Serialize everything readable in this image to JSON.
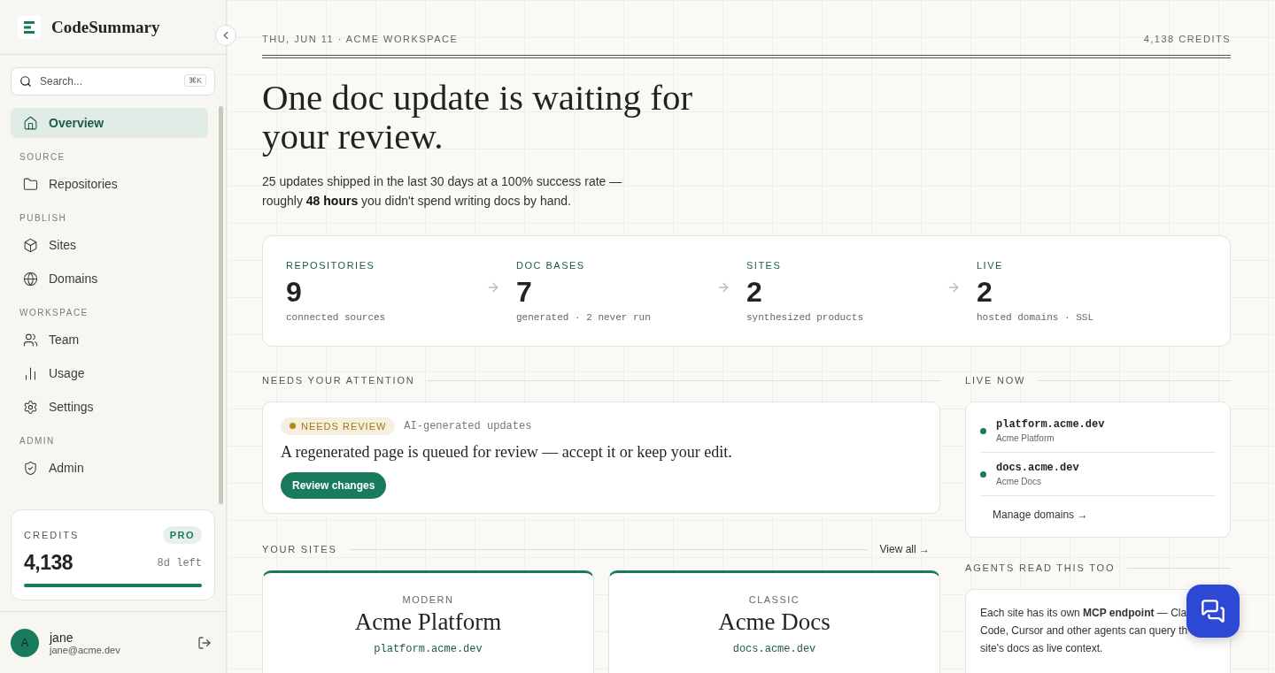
{
  "brand": {
    "name": "CodeSummary"
  },
  "search": {
    "placeholder": "Search...",
    "shortcut": "⌘K"
  },
  "nav": [
    {
      "kind": "item",
      "label": "Overview",
      "selected": true
    },
    {
      "kind": "section",
      "label": "SOURCE"
    },
    {
      "kind": "item",
      "label": "Repositories",
      "selected": false
    },
    {
      "kind": "section",
      "label": "PUBLISH"
    },
    {
      "kind": "item",
      "label": "Sites",
      "selected": false
    },
    {
      "kind": "item",
      "label": "Domains",
      "selected": false
    },
    {
      "kind": "section",
      "label": "WORKSPACE"
    },
    {
      "kind": "item",
      "label": "Team",
      "selected": false
    },
    {
      "kind": "item",
      "label": "Usage",
      "selected": false
    },
    {
      "kind": "item",
      "label": "Settings",
      "selected": false
    },
    {
      "kind": "section",
      "label": "ADMIN"
    },
    {
      "kind": "item",
      "label": "Admin",
      "selected": false
    }
  ],
  "credits": {
    "label": "CREDITS",
    "plan": "PRO",
    "amount": "4,138",
    "remaining": "8d left",
    "level": 1
  },
  "user": {
    "initial": "A",
    "name": "jane",
    "email": "jane@acme.dev"
  },
  "header": {
    "context": "THU, JUN 11 · ACME WORKSPACE",
    "credits": "4,138 CREDITS"
  },
  "headline": "One doc update is waiting for your review.",
  "summary": "25 updates shipped in the last 30 days at a 100% success rate — roughly **48 hours** you didn't spend writing docs by hand.",
  "stats": [
    {
      "label": "REPOSITORIES",
      "value": "9",
      "caption": "connected sources"
    },
    {
      "label": "DOC BASES",
      "value": "7",
      "caption": "generated · 2 never run"
    },
    {
      "label": "SITES",
      "value": "2",
      "caption": "synthesized products"
    },
    {
      "label": "LIVE",
      "value": "2",
      "caption": "hosted domains · SSL"
    }
  ],
  "attention": {
    "title": "NEEDS YOUR ATTENTION",
    "badge": "NEEDS REVIEW",
    "tag": "AI-generated updates",
    "message": "A regenerated page is queued for review — accept it or keep your edit.",
    "action": "Review changes"
  },
  "live": {
    "title": "LIVE NOW",
    "domains": [
      {
        "host": "platform.acme.dev",
        "site": "Acme Platform",
        "color": "#1a7a5e"
      },
      {
        "host": "docs.acme.dev",
        "site": "Acme Docs",
        "color": "#1a7a5e"
      }
    ],
    "manage": "Manage domains →"
  },
  "sites": {
    "title": "YOUR SITES",
    "view_all": "View all →",
    "items": [
      {
        "style": "MODERN",
        "name": "Acme Platform",
        "host": "platform.acme.dev"
      },
      {
        "style": "CLASSIC",
        "name": "Acme Docs",
        "host": "docs.acme.dev"
      }
    ]
  },
  "agents": {
    "title": "AGENTS READ THIS TOO",
    "lines": [
      "Each site has its own **MCP endpoint** — Cla",
      "Code, Cursor and other agents can query th",
      "site's docs as live context."
    ]
  }
}
